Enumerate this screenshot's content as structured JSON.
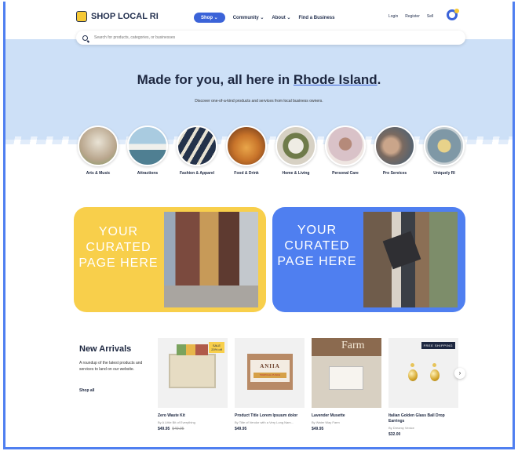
{
  "brand": {
    "name": "SHOP LOCAL RI",
    "accent": "#3b63d8",
    "yellow": "#f8cf4b",
    "blue": "#4f7ff0"
  },
  "nav": {
    "links": [
      {
        "label": "Shop ⌄"
      },
      {
        "label": "Community ⌄"
      },
      {
        "label": "About ⌄"
      },
      {
        "label": "Find a Business"
      }
    ],
    "login": "Login",
    "register": "Register",
    "sell": "Sell"
  },
  "search": {
    "placeholder": "Search for products, categories, or businesses",
    "icon": "search-icon"
  },
  "hero": {
    "title_prefix": "Made for you, all here in ",
    "title_highlight": "Rhode Island",
    "title_suffix": ".",
    "subtitle": "Discover one-of-a-kind products and services from local business owners."
  },
  "categories": [
    {
      "label": "Arts & Music",
      "color": "#b9a68d"
    },
    {
      "label": "Attractions",
      "color": "#6f9fb8"
    },
    {
      "label": "Fashion & Apparel",
      "color": "#24324a"
    },
    {
      "label": "Food & Drink",
      "color": "#c8742a"
    },
    {
      "label": "Home & Living",
      "color": "#d7d1c4"
    },
    {
      "label": "Personal Care",
      "color": "#c9a89a"
    },
    {
      "label": "Pro Services",
      "color": "#7b6a60"
    },
    {
      "label": "Uniquely RI",
      "color": "#8fa6b3"
    }
  ],
  "promos": [
    {
      "text": "YOUR CURATED PAGE HERE"
    },
    {
      "text": "YOUR CURATED PAGE HERE"
    }
  ],
  "new_arrivals": {
    "title": "New Arrivals",
    "description": "A roundup of the latest products and services to land on our website.",
    "shop_all": "Shop all",
    "products": [
      {
        "name": "Zero Waste Kit",
        "vendor": "By A Little Bit of Everything",
        "price": "$49.95",
        "old_price": "$49.95",
        "badge": "SALE 20% off"
      },
      {
        "name": "Product Title Lorem Ipsuum dolor",
        "vendor": "By Title of Vendor with a Very Long Nam...",
        "price": "$49.95",
        "img_text": "ANIIA",
        "img_sub": "TROPICAL PUNCH"
      },
      {
        "name": "Lavender Musette",
        "vendor": "By Water Way Farm",
        "price": "$49.95",
        "img_text": "Farm"
      },
      {
        "name": "Italian Golden Glass Ball Drop Earrings",
        "vendor": "By Dreamy Venice",
        "price": "$32.00",
        "badge": "FREE SHIPPING"
      }
    ]
  }
}
